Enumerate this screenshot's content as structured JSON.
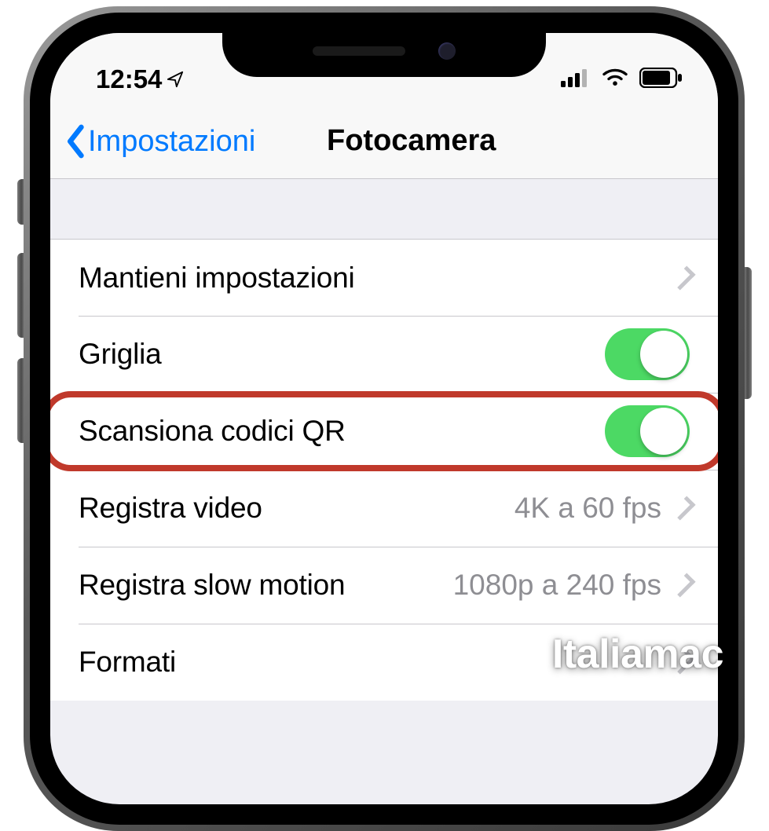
{
  "statusbar": {
    "time": "12:54"
  },
  "nav": {
    "back_label": "Impostazioni",
    "title": "Fotocamera"
  },
  "rows": {
    "keep_settings": {
      "label": "Mantieni impostazioni"
    },
    "grid": {
      "label": "Griglia"
    },
    "scan_qr": {
      "label": "Scansiona codici QR"
    },
    "record_video": {
      "label": "Registra video",
      "value": "4K a 60 fps"
    },
    "record_slowmo": {
      "label": "Registra slow motion",
      "value": "1080p a 240 fps"
    },
    "formats": {
      "label": "Formati"
    }
  },
  "watermark": "Italiamac"
}
